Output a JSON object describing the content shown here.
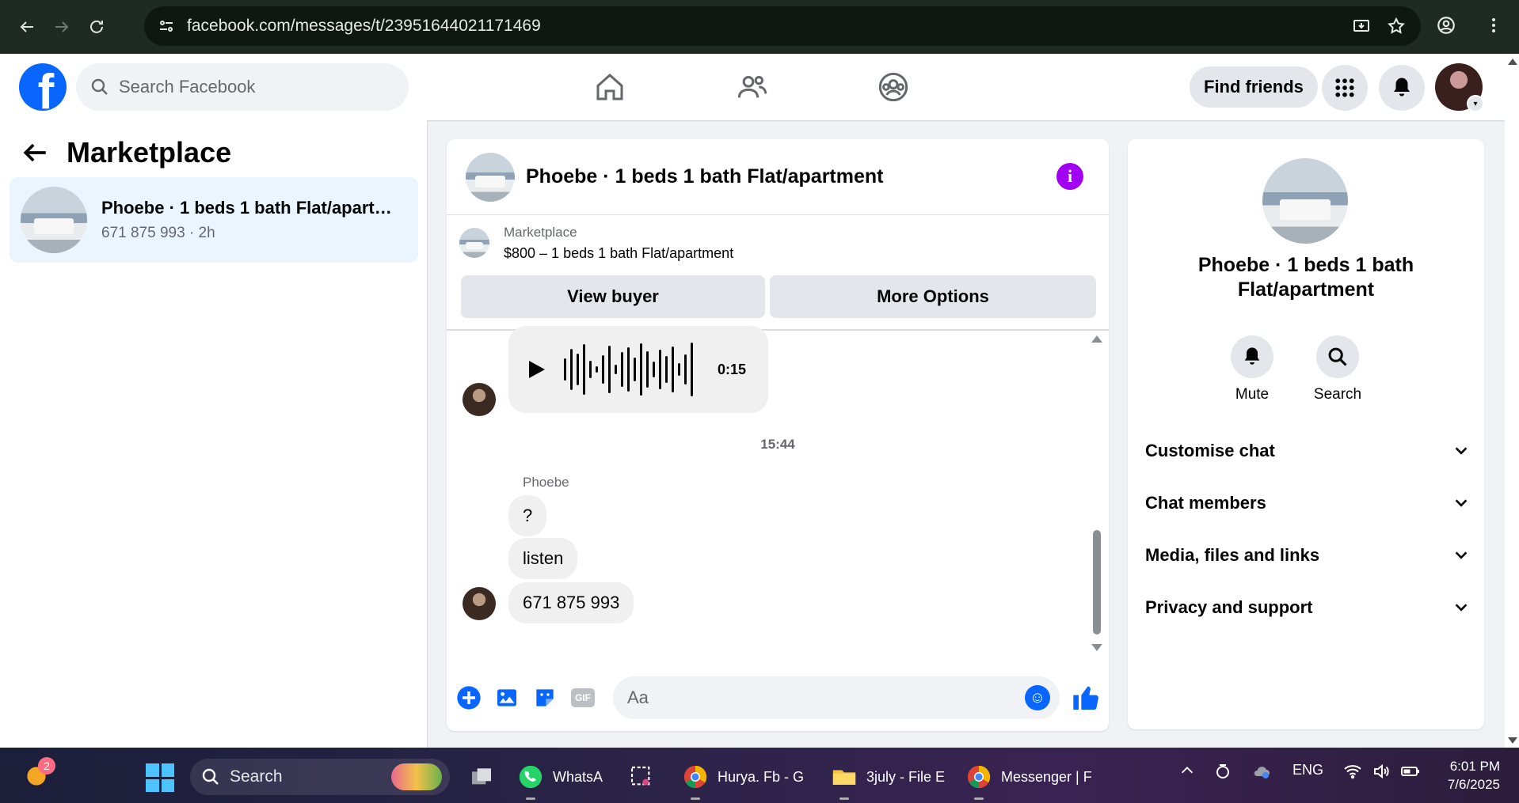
{
  "browser": {
    "url": "facebook.com/messages/t/23951644021171469"
  },
  "header": {
    "search_placeholder": "Search Facebook",
    "find_friends": "Find friends",
    "logo": "f"
  },
  "sidebar": {
    "title": "Marketplace",
    "conversation": {
      "name": "Phoebe · 1 beds 1 bath Flat/apartm...",
      "sub": "671 875 993 · 2h"
    }
  },
  "chat": {
    "title": "Phoebe · 1 beds 1 bath Flat/apartment",
    "marketplace_label": "Marketplace",
    "listing": "$800 – 1 beds 1 bath Flat/apartment",
    "view_buyer": "View buyer",
    "more_options": "More Options",
    "voice_duration": "0:15",
    "time_separator": "15:44",
    "sender": "Phoebe",
    "messages": [
      "?",
      "listen",
      "671 875 993"
    ],
    "composer_placeholder": "Aa",
    "gif_label": "GIF"
  },
  "info_panel": {
    "title": "Phoebe · 1 beds 1 bath Flat/apartment",
    "mute": "Mute",
    "search": "Search",
    "sections": [
      "Customise chat",
      "Chat members",
      "Media, files and links",
      "Privacy and support"
    ]
  },
  "taskbar": {
    "badge": "2",
    "search": "Search",
    "apps": [
      {
        "name": "WhatsA"
      },
      {
        "name": "Hurya. Fb - G"
      },
      {
        "name": "3july - File E"
      },
      {
        "name": "Messenger | F"
      }
    ],
    "lang": "ENG",
    "time": "6:01 PM",
    "date": "7/6/2025"
  },
  "colors": {
    "fb_blue": "#0866ff",
    "info_purple": "#a100f2",
    "selected_bg": "#ebf5ff"
  }
}
